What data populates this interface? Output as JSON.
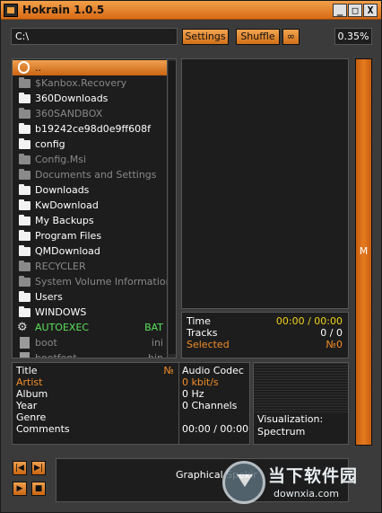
{
  "window": {
    "title": "Hokrain 1.0.5",
    "controls": [
      "_",
      "□",
      "X"
    ]
  },
  "toolbar": {
    "path_value": "C:\\",
    "settings_label": "Settings",
    "shuffle_label": "Shuffle",
    "repeat_label": "∞",
    "progress_text": "0.35%"
  },
  "files": [
    {
      "name": "..",
      "type": "up"
    },
    {
      "name": "$Kanbox.Recovery",
      "type": "folder-dim"
    },
    {
      "name": "360Downloads",
      "type": "folder"
    },
    {
      "name": "360SANDBOX",
      "type": "folder-dim"
    },
    {
      "name": "b19242ce98d0e9ff608f",
      "type": "folder"
    },
    {
      "name": "config",
      "type": "folder"
    },
    {
      "name": "Config.Msi",
      "type": "folder-dim"
    },
    {
      "name": "Documents and Settings",
      "type": "folder-dim"
    },
    {
      "name": "Downloads",
      "type": "folder"
    },
    {
      "name": "KwDownload",
      "type": "folder"
    },
    {
      "name": "My Backups",
      "type": "folder"
    },
    {
      "name": "Program Files",
      "type": "folder"
    },
    {
      "name": "QMDownload",
      "type": "folder"
    },
    {
      "name": "RECYCLER",
      "type": "folder-dim"
    },
    {
      "name": "System Volume Information",
      "type": "folder-dim"
    },
    {
      "name": "Users",
      "type": "folder"
    },
    {
      "name": "WINDOWS",
      "type": "folder"
    },
    {
      "name": "AUTOEXEC",
      "ext": "BAT",
      "type": "exec"
    },
    {
      "name": "boot",
      "ext": "ini",
      "type": "file-dim"
    },
    {
      "name": "bootfont",
      "ext": "bin",
      "type": "file-dim"
    }
  ],
  "track_info": {
    "time_label": "Time",
    "time_value": "00:00 / 00:00",
    "tracks_label": "Tracks",
    "tracks_value": "0 / 0",
    "selected_label": "Selected",
    "selected_value": "№0"
  },
  "side_button": {
    "label": "M"
  },
  "metadata": {
    "title_label": "Title",
    "number_label": "№",
    "artist_label": "Artist",
    "album_label": "Album",
    "year_label": "Year",
    "genre_label": "Genre",
    "comments_label": "Comments"
  },
  "codec": {
    "codec_label": "Audio Codec",
    "bitrate": "0 kbit/s",
    "samplerate": "0 Hz",
    "channels": "0 Channels",
    "position": "00:00 / 00:00"
  },
  "visualization": {
    "label": "Visualization:",
    "mode": "Spectrum"
  },
  "transport": {
    "prev_symbol": "|◀",
    "next_symbol": "▶|",
    "play_symbol": "▶",
    "stop_symbol": "■"
  },
  "scope": {
    "text": "Graphical Spekir"
  },
  "watermark": {
    "cn": "当下软件园",
    "en": "downxia.com"
  },
  "colors": {
    "accent": "#e07818",
    "highlight": "#f08c2a",
    "exec": "#5be05b",
    "time_value": "#f0d21a"
  }
}
